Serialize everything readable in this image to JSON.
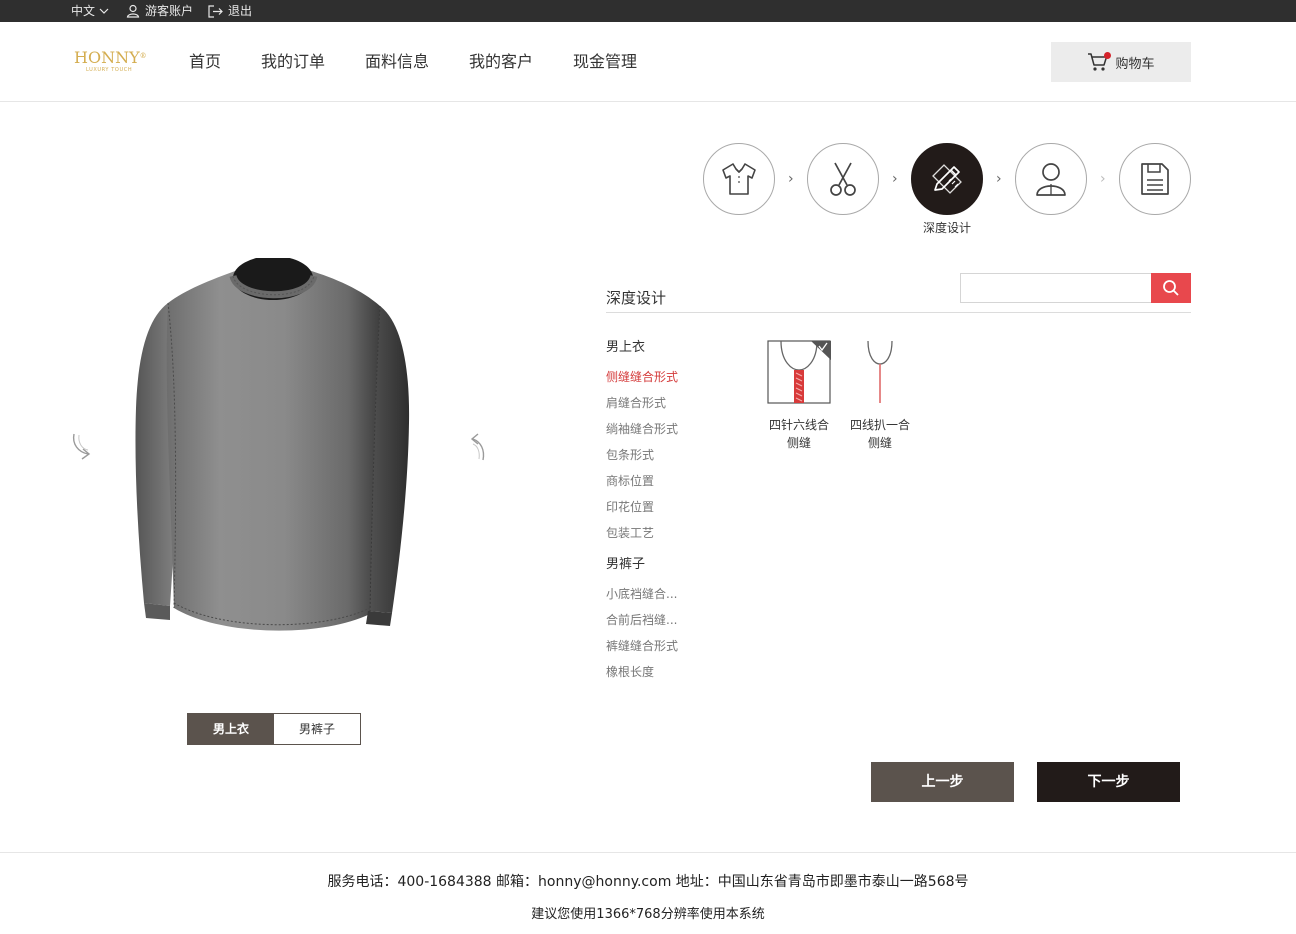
{
  "topbar": {
    "language": "中文",
    "account": "游客账户",
    "logout": "退出"
  },
  "header": {
    "logo": {
      "brand": "HONNY",
      "tagline": "LUXURY TOUCH"
    },
    "nav": [
      "首页",
      "我的订单",
      "面料信息",
      "我的客户",
      "现金管理"
    ],
    "cart_label": "购物车"
  },
  "steps": {
    "items": [
      {
        "icon": "shirt-icon",
        "state": "done"
      },
      {
        "icon": "scissors-icon",
        "state": "done"
      },
      {
        "icon": "pencil-ruler-icon",
        "state": "active"
      },
      {
        "icon": "user-icon",
        "state": "todo"
      },
      {
        "icon": "save-icon",
        "state": "todo"
      }
    ],
    "active_label": "深度设计"
  },
  "preview": {
    "toggle": [
      "男上衣",
      "男裤子"
    ],
    "selected": "男上衣"
  },
  "panel": {
    "title": "深度设计",
    "search_placeholder": "",
    "categories": [
      {
        "name": "男上衣",
        "items": [
          "侧缝缝合形式",
          "肩缝合形式",
          "绱袖缝合形式",
          "包条形式",
          "商标位置",
          "印花位置",
          "包装工艺"
        ]
      },
      {
        "name": "男裤子",
        "items": [
          "小底裆缝合...",
          "合前后裆缝...",
          "裤缝缝合形式",
          "橡根长度"
        ]
      }
    ],
    "active_item": "侧缝缝合形式",
    "options": [
      {
        "line1": "四针六线合",
        "line2": "侧缝",
        "selected": true
      },
      {
        "line1": "四线扒一合",
        "line2": "侧缝",
        "selected": false
      }
    ]
  },
  "buttons": {
    "prev": "上一步",
    "next": "下一步"
  },
  "footer": {
    "line1": "服务电话：400-1684388 邮箱：honny@honny.com 地址：中国山东省青岛市即墨市泰山一路568号",
    "line2": "建议您使用1366*768分辨率使用本系统"
  },
  "colors": {
    "accent_red": "#e8484d",
    "dark": "#221b19",
    "secondary": "#5b534d",
    "brand_gold": "#d4ad4f"
  }
}
